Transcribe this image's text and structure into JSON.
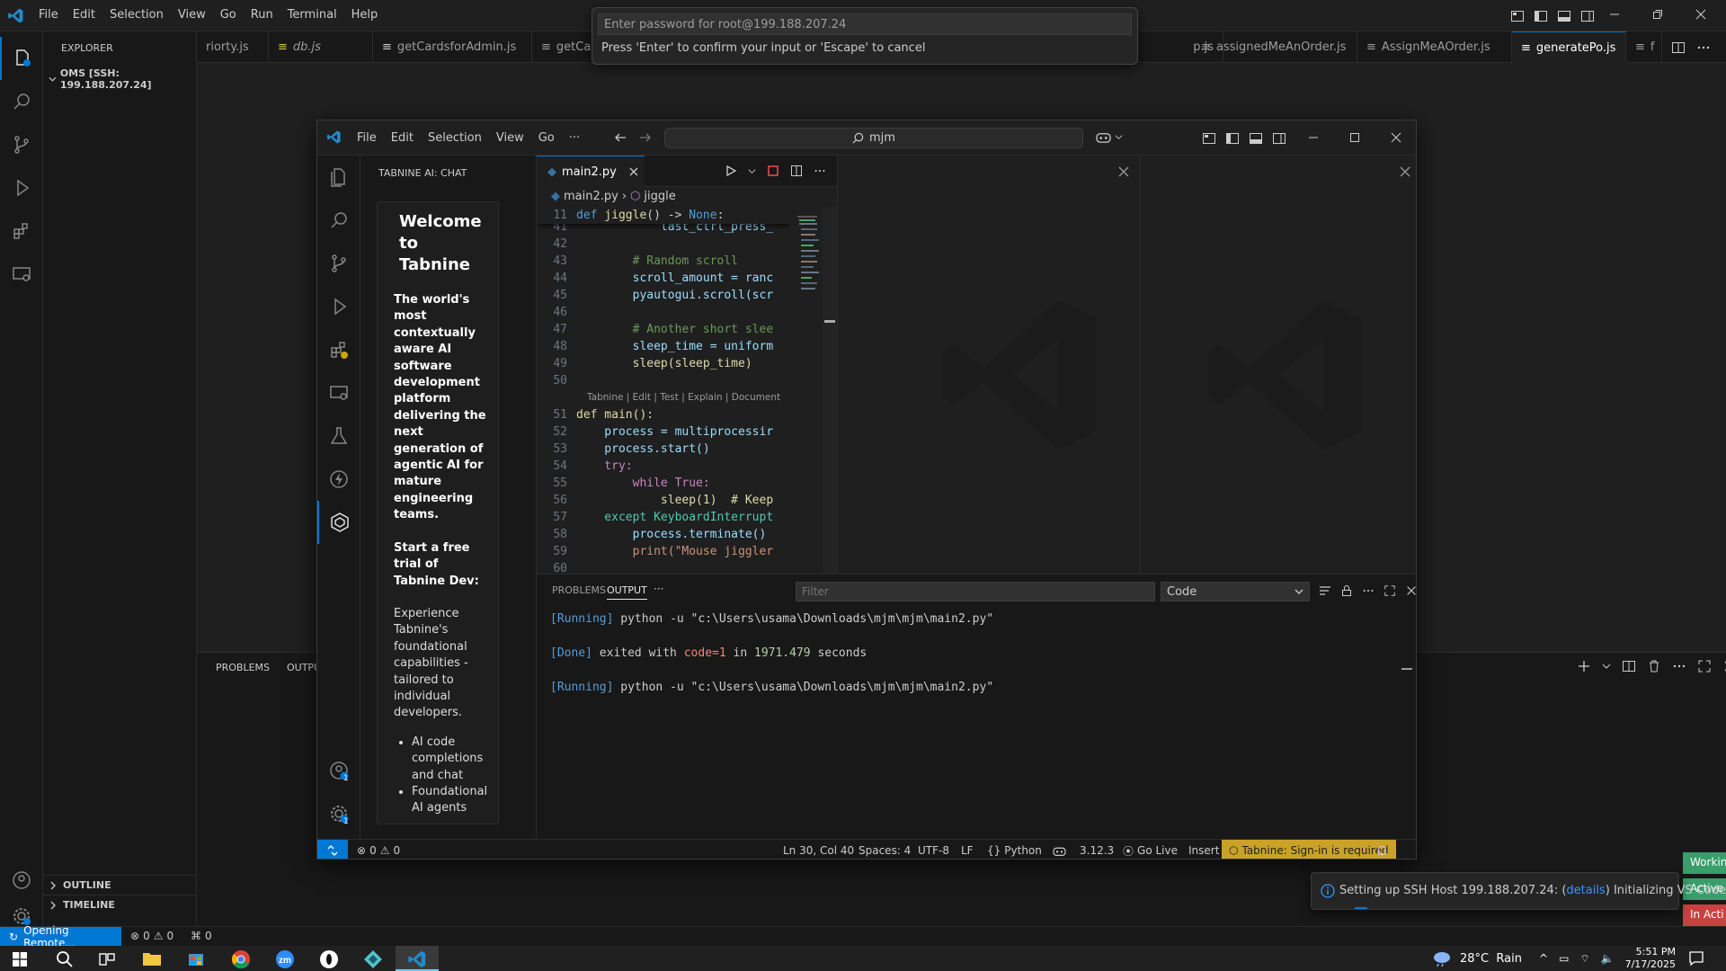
{
  "outer": {
    "menu": [
      "File",
      "Edit",
      "Selection",
      "View",
      "Go",
      "Run",
      "Terminal",
      "Help"
    ],
    "explorer_title": "EXPLORER",
    "workspace": "OMS [SSH: 199.188.207.24]",
    "tabs": [
      {
        "label": "riorty.js"
      },
      {
        "label": "db.js"
      },
      {
        "label": "getCardsforAdmin.js"
      },
      {
        "label": "getCa"
      },
      {
        "label": "p.js"
      },
      {
        "label": "assignedMeAnOrder.js"
      },
      {
        "label": "AssignMeAOrder.js"
      },
      {
        "label": "generatePo.js"
      },
      {
        "label": "f"
      }
    ],
    "panel_tabs": [
      "PROBLEMS",
      "OUTPU"
    ],
    "outline": "OUTLINE",
    "timeline": "TIMELINE",
    "status": {
      "remote": "Opening Remote...",
      "errors": "0",
      "warnings": "0",
      "ports": "0"
    },
    "notification": {
      "prefix": "Setting up SSH Host 199.188.207.24: (",
      "link": "details",
      "suffix": ") Initializing VS Code"
    },
    "side_badges": [
      "Workin",
      "Active",
      "In Acti"
    ]
  },
  "quickpick": {
    "placeholder": "Enter password for root@199.188.207.24",
    "hint": "Press 'Enter' to confirm your input or 'Escape' to cancel"
  },
  "inner": {
    "menu": [
      "File",
      "Edit",
      "Selection",
      "View",
      "Go",
      "···"
    ],
    "search": "mjm",
    "sidebar_title": "TABNINE AI: CHAT",
    "tabnine": {
      "heading": "Welcome to Tabnine",
      "tagline": "The world's most contextually aware AI software development platform delivering the next generation of agentic AI for mature engineering teams.",
      "trial": "Start a free trial of Tabnine Dev:",
      "body": "Experience Tabnine's foundational capabilities - tailored to individual developers.",
      "bullets": [
        "AI code completions and chat",
        "Foundational AI agents"
      ]
    },
    "tab": "main2.py",
    "breadcrumb": [
      "main2.py",
      "jiggle"
    ],
    "sticky": {
      "num": "11",
      "text": "def jiggle() -> None:"
    },
    "codelens": "Tabnine | Edit | Test | Explain | Document",
    "lines": [
      {
        "n": "41",
        "t": "            last_ctrl_press_"
      },
      {
        "n": "42",
        "t": ""
      },
      {
        "n": "43",
        "t": "        # Random scroll"
      },
      {
        "n": "44",
        "t": "        scroll_amount = ranc"
      },
      {
        "n": "45",
        "t": "        pyautogui.scroll(scr"
      },
      {
        "n": "46",
        "t": ""
      },
      {
        "n": "47",
        "t": "        # Another short slee"
      },
      {
        "n": "48",
        "t": "        sleep_time = uniform"
      },
      {
        "n": "49",
        "t": "        sleep(sleep_time)"
      },
      {
        "n": "50",
        "t": ""
      },
      {
        "n": "51",
        "t": "def main():"
      },
      {
        "n": "52",
        "t": "    process = multiprocessir"
      },
      {
        "n": "53",
        "t": "    process.start()"
      },
      {
        "n": "54",
        "t": "    try:"
      },
      {
        "n": "55",
        "t": "        while True:"
      },
      {
        "n": "56",
        "t": "            sleep(1)  # Keep"
      },
      {
        "n": "57",
        "t": "    except KeyboardInterrupt"
      },
      {
        "n": "58",
        "t": "        process.terminate()"
      },
      {
        "n": "59",
        "t": "        print(\"Mouse jiggler"
      },
      {
        "n": "60",
        "t": ""
      }
    ],
    "panel": {
      "tabs": [
        "PROBLEMS",
        "OUTPUT",
        "···"
      ],
      "filter_placeholder": "Filter",
      "channel": "Code",
      "output": [
        {
          "tag": "[Running]",
          "text": " python -u \"c:\\Users\\usama\\Downloads\\mjm\\mjm\\main2.py\""
        },
        {
          "tag": "[Done]",
          "text": " exited with ",
          "code": "code=1",
          "mid": " in ",
          "num": "1971.479",
          "end": " seconds"
        },
        {
          "tag": "[Running]",
          "text": " python -u \"c:\\Users\\usama\\Downloads\\mjm\\mjm\\main2.py\""
        }
      ]
    },
    "status": {
      "errors": "0",
      "warnings": "0",
      "position": "Ln 30, Col 40",
      "spaces": "Spaces: 4",
      "encoding": "UTF-8",
      "eol": "LF",
      "language": "Python",
      "version": "3.12.3",
      "golive": "Go Live",
      "mode": "Insert",
      "tabnine": "Tabnine: Sign-in is required"
    },
    "badges": {
      "extensions": "",
      "accounts": "1",
      "manage": "1"
    }
  },
  "taskbar": {
    "weather": "28°C  Rain",
    "time": "5:51 PM",
    "date": "7/17/2025"
  },
  "colors": {
    "accent": "#0078d4",
    "tabnine_status": "#c9a227",
    "remote": "#0078d4",
    "badge_green": "#389e6b",
    "badge_red": "#c8423f"
  }
}
